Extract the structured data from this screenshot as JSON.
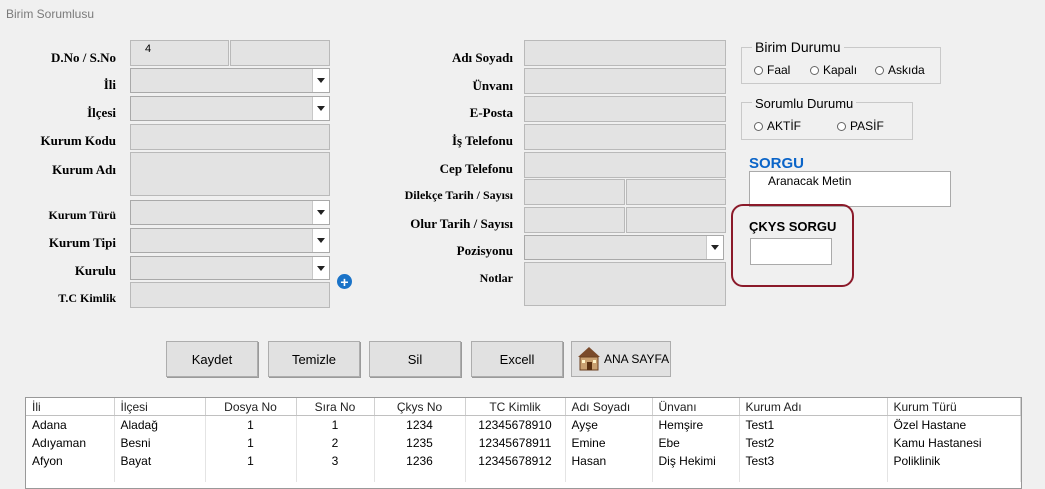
{
  "window": {
    "title": "Birim Sorumlusu"
  },
  "left": {
    "dno_label": "D.No / S.No",
    "dno_value": "4",
    "sno_value": "",
    "il_label": "İli",
    "ilce_label": "İlçesi",
    "kurum_kodu_label": "Kurum Kodu",
    "kurum_adi_label": "Kurum Adı",
    "kurum_turu_label": "Kurum Türü",
    "kurum_tipi_label": "Kurum Tipi",
    "kurulu_label": "Kurulu",
    "tc_label": "T.C Kimlik"
  },
  "middle": {
    "adi_soyadi_label": "Adı Soyadı",
    "unvani_label": "Ünvanı",
    "eposta_label": "E-Posta",
    "is_tel_label": "İş Telefonu",
    "cep_tel_label": "Cep Telefonu",
    "dilekce_label": "Dilekçe Tarih / Sayısı",
    "olur_label": "Olur Tarih / Sayısı",
    "pozisyon_label": "Pozisyonu",
    "notlar_label": "Notlar"
  },
  "birim_durumu": {
    "title": "Birim Durumu",
    "options": [
      "Faal",
      "Kapalı",
      "Askıda"
    ]
  },
  "sorumlu_durumu": {
    "title": "Sorumlu Durumu",
    "options": [
      "AKTİF",
      "PASİF"
    ]
  },
  "sorgu": {
    "title": "SORGU",
    "text": "Aranacak Metin"
  },
  "ckys": {
    "title": "ÇKYS SORGU",
    "value": ""
  },
  "buttons": {
    "kaydet": "Kaydet",
    "temizle": "Temizle",
    "sil": "Sil",
    "excell": "Excell",
    "ana_sayfa": "ANA SAYFA"
  },
  "table": {
    "headers": [
      "İli",
      "İlçesi",
      "Dosya No",
      "Sıra No",
      "Çkys No",
      "TC Kimlik",
      "Adı Soyadı",
      "Ünvanı",
      "Kurum Adı",
      "Kurum Türü"
    ],
    "rows": [
      [
        "Adana",
        "Aladağ",
        "1",
        "1",
        "1234",
        "12345678910",
        "Ayşe",
        "Hemşire",
        "Test1",
        "Özel Hastane"
      ],
      [
        "Adıyaman",
        "Besni",
        "1",
        "2",
        "1235",
        "12345678911",
        "Emine",
        "Ebe",
        "Test2",
        "Kamu Hastanesi"
      ],
      [
        "Afyon",
        "Bayat",
        "1",
        "3",
        "1236",
        "12345678912",
        "Hasan",
        "Diş Hekimi",
        "Test3",
        "Poliklinik"
      ]
    ]
  },
  "colors": {
    "accent_blue": "#0a64c8",
    "ckys_border": "#8b1a2a"
  }
}
